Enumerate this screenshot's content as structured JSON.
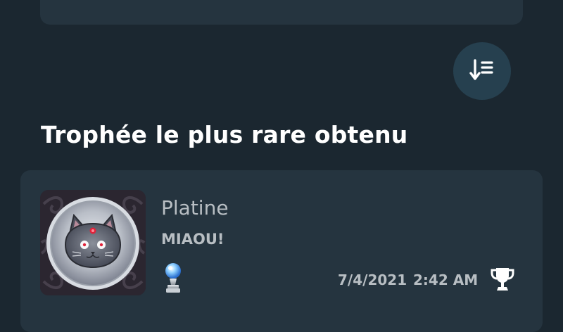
{
  "section": {
    "title": "Trophée le plus rare obtenu"
  },
  "sort_button": {
    "icon": "sort-descending-icon"
  },
  "trophy": {
    "name": "Platine",
    "description": "MIAOU!",
    "tier_icon": "platinum-trophy-icon",
    "earned_date": "7/4/2021",
    "earned_time": "2:42 AM",
    "type_icon": "trophy-cup-icon"
  },
  "colors": {
    "background": "#1b2730",
    "card": "#25343f",
    "button": "#26404f",
    "text_primary": "#ffffff",
    "text_secondary": "#b8bec3",
    "platinum_blue": "#6fb8ff"
  }
}
